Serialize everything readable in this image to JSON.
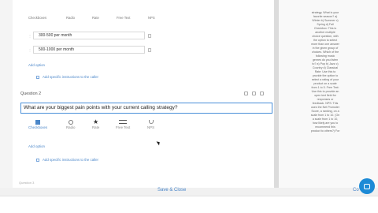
{
  "question_types_top": [
    "Checkboxes",
    "Radio",
    "Rate",
    "Free Text",
    "NPS"
  ],
  "options": [
    {
      "value": "300-500 per month"
    },
    {
      "value": "500-1000 per month"
    }
  ],
  "add_option_label": "Add option",
  "add_instructions_label": "Add specific instructions to the caller",
  "question2": {
    "label": "Question 2",
    "text": "What are your biggest pain points with your current calling strategy?"
  },
  "question_types": [
    {
      "label": "Checkboxes",
      "icon": "checkbox-icon"
    },
    {
      "label": "Radio",
      "icon": "radio-icon"
    },
    {
      "label": "Rate",
      "icon": "star-icon"
    },
    {
      "label": "Free Text",
      "icon": "free-text-icon"
    },
    {
      "label": "NPS",
      "icon": "nps-icon"
    }
  ],
  "next_question_label": "Question 3",
  "footer": {
    "save_close": "Save & Close",
    "cutoff": "Co"
  },
  "help_text": "strategy. What is your\nfavorite season? a)\nWinter b) Summer c)\nSpring d) Fall\nCheckbox: This is\nanother multiple\nchoice question, with\nthe option to select\nmore than one answer\nin the given group of\nchoices. Which of the\nfollowing music\ngenres do you listen\nto? a) Pop b) Jazz c)\nCountry d) Classical\nRate: Use this to\nprovide the option to\nselect a rating of your\nproduct on a scale\nfrom 1 to 5. Free Text:\nUse this to provide an\nopen text field for\nresponses or\nfeedback. NPS: This\nuses the Net Promoter\nScore, a ranking, on a\nscale from 1 to 10. (On\na scale from 1 to 10,\nhow likely are you to\nrecommend this\nproduct to others?) For",
  "colors": {
    "accent": "#4a86c9",
    "chat": "#1d8ad6",
    "focus_border": "#4a90d9"
  }
}
